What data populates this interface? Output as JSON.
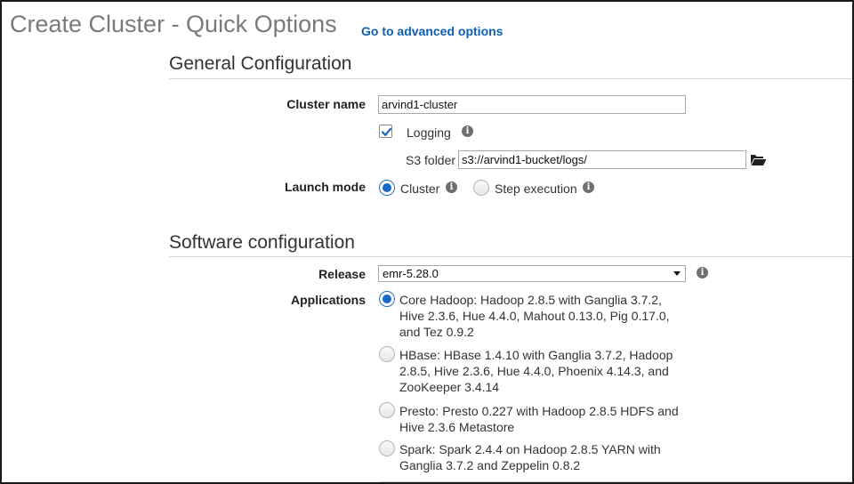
{
  "header": {
    "title": "Create Cluster - Quick Options",
    "advanced_link": "Go to advanced options"
  },
  "general": {
    "section_title": "General Configuration",
    "cluster_name_label": "Cluster name",
    "cluster_name_value": "arvind1-cluster",
    "logging_label": "Logging",
    "logging_checked": true,
    "s3_folder_label": "S3 folder",
    "s3_folder_value": "s3://arvind1-bucket/logs/",
    "launch_mode_label": "Launch mode",
    "launch_modes": [
      {
        "label": "Cluster",
        "selected": true
      },
      {
        "label": "Step execution",
        "selected": false
      }
    ]
  },
  "software": {
    "section_title": "Software configuration",
    "release_label": "Release",
    "release_value": "emr-5.28.0",
    "applications_label": "Applications",
    "applications": [
      {
        "selected": true,
        "lines": [
          "Core Hadoop: Hadoop 2.8.5 with Ganglia 3.7.2,",
          "Hive 2.3.6, Hue 4.4.0, Mahout 0.13.0, Pig 0.17.0,",
          "and Tez 0.9.2"
        ]
      },
      {
        "selected": false,
        "lines": [
          "HBase: HBase 1.4.10 with Ganglia 3.7.2, Hadoop",
          "2.8.5, Hive 2.3.6, Hue 4.4.0, Phoenix 4.14.3, and",
          "ZooKeeper 3.4.14"
        ]
      },
      {
        "selected": false,
        "lines": [
          "Presto: Presto 0.227 with Hadoop 2.8.5 HDFS and",
          "Hive 2.3.6 Metastore"
        ]
      },
      {
        "selected": false,
        "lines": [
          "Spark: Spark 2.4.4 on Hadoop 2.8.5 YARN with",
          "Ganglia 3.7.2 and Zeppelin 0.8.2"
        ]
      }
    ]
  },
  "colors": {
    "link": "#0b5fb6",
    "radio_selected": "#1967c4",
    "title": "#7a7a7a"
  },
  "icons": {
    "info": "info-icon",
    "folder": "folder-open-icon",
    "checkmark": "checkmark-icon",
    "dropdown": "chevron-down-icon"
  }
}
